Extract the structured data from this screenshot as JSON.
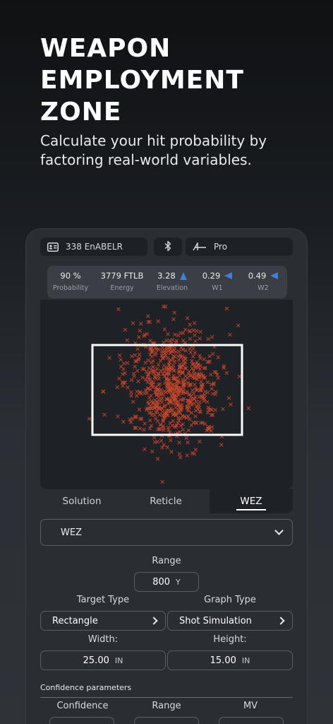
{
  "hero": {
    "title_lines": [
      "WEAPON",
      "EMPLOYMENT",
      "ZONE"
    ],
    "subtitle_line1": "Calculate your hit probability by",
    "subtitle_line2": "factoring real-world variables."
  },
  "topbar": {
    "profile_label": "338 EnABELR",
    "pro_label": "Pro",
    "icons": [
      "profile-card-icon",
      "bluetooth-icon",
      "pro-logo-icon"
    ]
  },
  "stats": [
    {
      "value": "90 %",
      "label": "Probability"
    },
    {
      "value": "3779 FTLB",
      "label": "Energy"
    },
    {
      "value": "3.28",
      "label": "Elevation",
      "icon": "arrow-up-icon"
    },
    {
      "value": "0.29",
      "label": "W1",
      "icon": "arrow-left-icon"
    },
    {
      "value": "0.49",
      "label": "W2",
      "icon": "arrow-left-icon"
    }
  ],
  "tabs": {
    "solution": "Solution",
    "reticle": "Reticle",
    "wez": "WEZ",
    "active": "WEZ"
  },
  "wez_select": {
    "value": "WEZ"
  },
  "range": {
    "label": "Range",
    "value": "800",
    "unit": "Y"
  },
  "target_type": {
    "label": "Target Type",
    "value": "Rectangle"
  },
  "graph_type": {
    "label": "Graph Type",
    "value": "Shot Simulation"
  },
  "width": {
    "label": "Width:",
    "value": "25.00",
    "unit": "IN"
  },
  "height": {
    "label": "Height:",
    "value": "15.00",
    "unit": "IN"
  },
  "confidence": {
    "title": "Confidence parameters",
    "columns": [
      "Confidence",
      "Range",
      "MV"
    ]
  },
  "colors": {
    "accent_arrow": "#3d7fe0",
    "shot_marker": "#c8462d",
    "target_outline": "#ffffff"
  }
}
